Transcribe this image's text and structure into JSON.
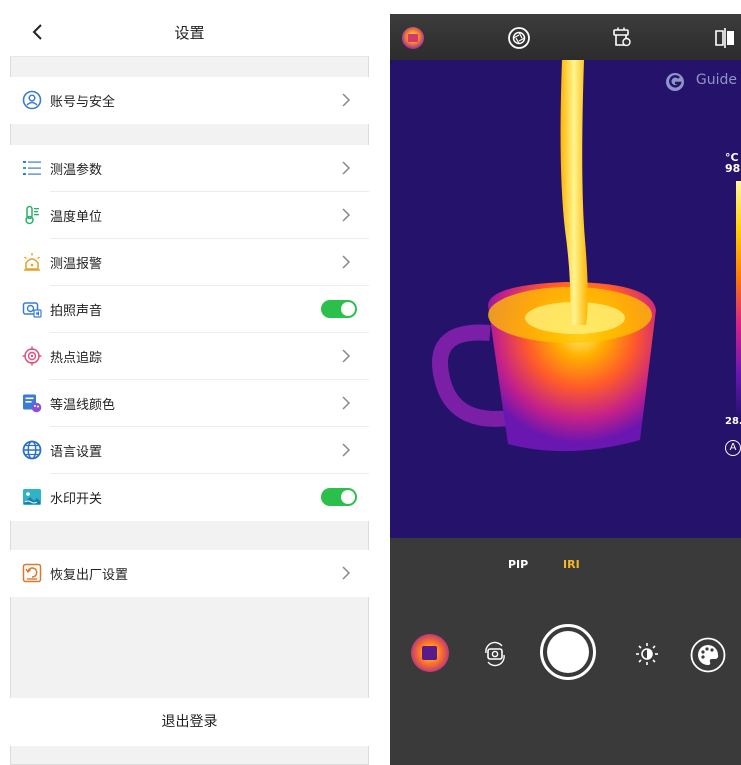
{
  "settings": {
    "title": "设置",
    "rows": [
      {
        "label": "账号与安全",
        "icon": "account-security-icon"
      },
      {
        "label": "测温参数",
        "icon": "parameters-icon"
      },
      {
        "label": "温度单位",
        "icon": "thermometer-icon"
      },
      {
        "label": "测温报警",
        "icon": "alarm-icon"
      },
      {
        "label": "拍照声音",
        "icon": "camera-sound-icon",
        "toggle": true
      },
      {
        "label": "热点追踪",
        "icon": "hotspot-target-icon"
      },
      {
        "label": "等温线颜色",
        "icon": "isotherm-color-icon"
      },
      {
        "label": "语言设置",
        "icon": "globe-icon"
      },
      {
        "label": "水印开关",
        "icon": "watermark-image-icon",
        "toggle": true
      },
      {
        "label": "恢复出厂设置",
        "icon": "factory-reset-icon"
      }
    ],
    "logout": "退出登录"
  },
  "camera": {
    "brand": "Guide",
    "scale_unit": "°C",
    "scale_max": "98.",
    "scale_min": "28.",
    "auto_label": "A",
    "modes": [
      {
        "label": "PIP",
        "active": false
      },
      {
        "label": "IRI",
        "active": true
      }
    ]
  },
  "colors": {
    "toggle_on": "#2bbf4b",
    "accent_blue": "#3a7bd5",
    "mode_active": "#f5b62b"
  }
}
